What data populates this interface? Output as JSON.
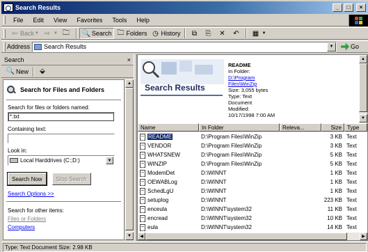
{
  "window": {
    "title": "Search Results",
    "minimize": "_",
    "maximize": "□",
    "close": "×"
  },
  "menu": [
    "File",
    "Edit",
    "View",
    "Favorites",
    "Tools",
    "Help"
  ],
  "toolbar": {
    "back": "Back",
    "search": "Search",
    "folders": "Folders",
    "history": "History"
  },
  "address": {
    "label": "Address",
    "value": "Search Results",
    "go": "Go"
  },
  "search_pane": {
    "header": "Search",
    "close": "×",
    "new_label": "New",
    "heading": "Search for Files and Folders",
    "named_label": "Search for files or folders named:",
    "named_value": "*.txt",
    "containing_label": "Containing text:",
    "containing_value": "",
    "lookin_label": "Look in:",
    "lookin_value": "Local Harddrives (C:;D:)",
    "search_now": "Search Now",
    "stop_search": "Stop Search",
    "search_options": "Search Options >>",
    "other_items_label": "Search for other items:",
    "other_links": [
      "Files or Folders",
      "Computers"
    ]
  },
  "results": {
    "banner_title": "Search Results",
    "details": {
      "name": "README",
      "in_folder_label": "In Folder:",
      "in_folder_link1": "D:\\Program",
      "in_folder_link2": "Files\\WinZip",
      "size": "Size: 3,055 bytes",
      "type1": "Type: Text",
      "type2": "Document",
      "modified_label": "Modified:",
      "modified_value": "10/17/1998 7:00 AM"
    },
    "columns": [
      "Name",
      "In Folder",
      "Releva...",
      "Size",
      "Type"
    ],
    "rows": [
      {
        "name": "README",
        "folder": "D:\\Program Files\\WinZip",
        "rel": "",
        "size": "3 KB",
        "type": "Text",
        "selected": true
      },
      {
        "name": "VENDOR",
        "folder": "D:\\Program Files\\WinZip",
        "rel": "",
        "size": "3 KB",
        "type": "Text"
      },
      {
        "name": "WHATSNEW",
        "folder": "D:\\Program Files\\WinZip",
        "rel": "",
        "size": "5 KB",
        "type": "Text"
      },
      {
        "name": "WINZIP",
        "folder": "D:\\Program Files\\WinZip",
        "rel": "",
        "size": "5 KB",
        "type": "Text"
      },
      {
        "name": "ModemDet",
        "folder": "D:\\WINNT",
        "rel": "",
        "size": "1 KB",
        "type": "Text"
      },
      {
        "name": "OEWABLog",
        "folder": "D:\\WINNT",
        "rel": "",
        "size": "1 KB",
        "type": "Text"
      },
      {
        "name": "SchedLgU",
        "folder": "D:\\WINNT",
        "rel": "",
        "size": "1 KB",
        "type": "Text"
      },
      {
        "name": "setuplog",
        "folder": "D:\\WINNT",
        "rel": "",
        "size": "223 KB",
        "type": "Text"
      },
      {
        "name": "enceula",
        "folder": "D:\\WINNT\\system32",
        "rel": "",
        "size": "11 KB",
        "type": "Text"
      },
      {
        "name": "encread",
        "folder": "D:\\WINNT\\system32",
        "rel": "",
        "size": "10 KB",
        "type": "Text"
      },
      {
        "name": "eula",
        "folder": "D:\\WINNT\\system32",
        "rel": "",
        "size": "14 KB",
        "type": "Text"
      }
    ]
  },
  "status": "Type: Text Document Size: 2.98 KB"
}
